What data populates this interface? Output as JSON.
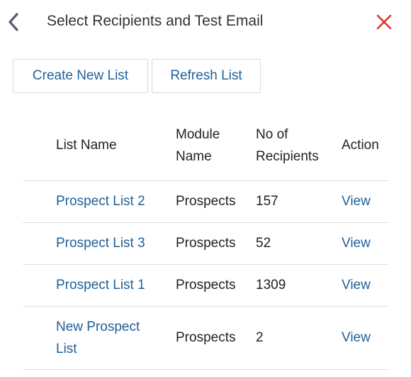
{
  "header": {
    "title": "Select Recipients and Test Email",
    "back_icon": "chevron-left-icon",
    "close_icon": "close-x-icon",
    "close_color": "#d9352c"
  },
  "toolbar": {
    "create_label": "Create New List",
    "refresh_label": "Refresh List"
  },
  "table": {
    "columns": {
      "list_name": "List Name",
      "module_name": "Module Name",
      "no_of_recipients": "No of Recipients",
      "action": "Action"
    },
    "rows": [
      {
        "list_name": "Prospect List 2",
        "module": "Prospects",
        "recipients": "157",
        "action": "View"
      },
      {
        "list_name": "Prospect List 3",
        "module": "Prospects",
        "recipients": "52",
        "action": "View"
      },
      {
        "list_name": "Prospect List 1",
        "module": "Prospects",
        "recipients": "1309",
        "action": "View"
      },
      {
        "list_name": "New Prospect List",
        "module": "Prospects",
        "recipients": "2",
        "action": "View"
      }
    ]
  },
  "colors": {
    "link": "#1f6199",
    "text": "#222222",
    "border": "#dcdfe3"
  }
}
